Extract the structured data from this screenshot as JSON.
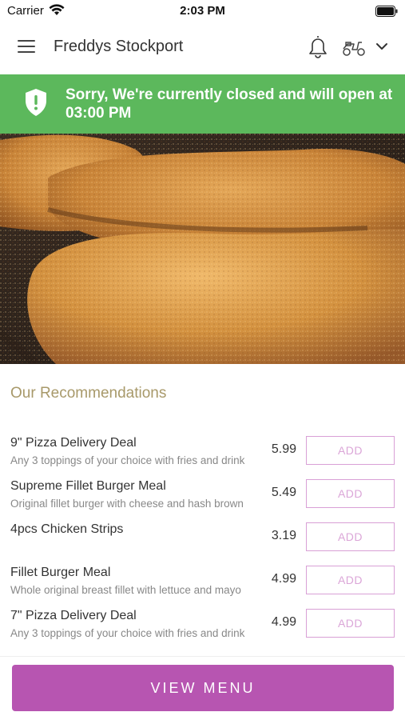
{
  "status_bar": {
    "carrier": "Carrier",
    "time": "2:03 PM"
  },
  "header": {
    "store_name": "Freddys Stockport",
    "icons": [
      "menu-icon",
      "bell-icon",
      "scooter-icon",
      "chevron-down-icon"
    ]
  },
  "banner": {
    "message": "Sorry, We're currently closed and will open at 03:00 PM",
    "color": "#5cb85c",
    "icon": "shield-icon"
  },
  "hero": {
    "subject": "fried chicken strips"
  },
  "recommendations": {
    "title": "Our Recommendations",
    "items": [
      {
        "name": "9\" Pizza Delivery Deal",
        "description": "Any 3 toppings of your choice with fries and drink",
        "price": "5.99",
        "button": "ADD"
      },
      {
        "name": "Supreme Fillet Burger Meal",
        "description": "Original fillet burger with cheese and hash brown",
        "price": "5.49",
        "button": "ADD"
      },
      {
        "name": "4pcs Chicken Strips",
        "description": "",
        "price": "3.19",
        "button": "ADD"
      },
      {
        "name": "Fillet Burger Meal",
        "description": "Whole original breast fillet with lettuce and mayo",
        "price": "4.99",
        "button": "ADD"
      },
      {
        "name": "7\" Pizza Delivery Deal",
        "description": "Any 3 toppings of your choice with fries and drink",
        "price": "4.99",
        "button": "ADD"
      }
    ]
  },
  "footer": {
    "view_menu_label": "VIEW MENU",
    "accent": "#b755b1"
  }
}
